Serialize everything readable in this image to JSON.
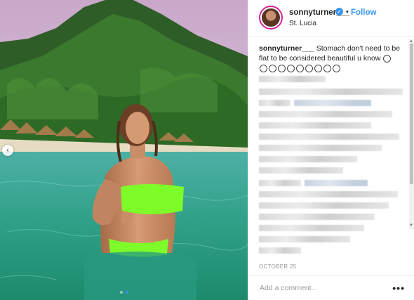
{
  "post": {
    "username": "sonnyturner___",
    "dot": "•",
    "follow_label": "Follow",
    "location": "St. Lucia",
    "caption_user": "sonnyturner___",
    "caption_text": "Stomach don't need to be flat to be considered beautiful u know",
    "date": "OCTOBER 25",
    "add_comment_placeholder": "Add a comment...",
    "more_label": "•••"
  },
  "icons": {
    "verified": "verified-badge-icon",
    "prev": "chevron-left-icon",
    "more": "more-options-icon"
  },
  "colors": {
    "accent": "#3897f0",
    "text": "#262626",
    "muted": "#999999",
    "swimsuit": "#7dfc2a"
  },
  "carousel": {
    "slide_count": 2,
    "active_index": 0
  }
}
